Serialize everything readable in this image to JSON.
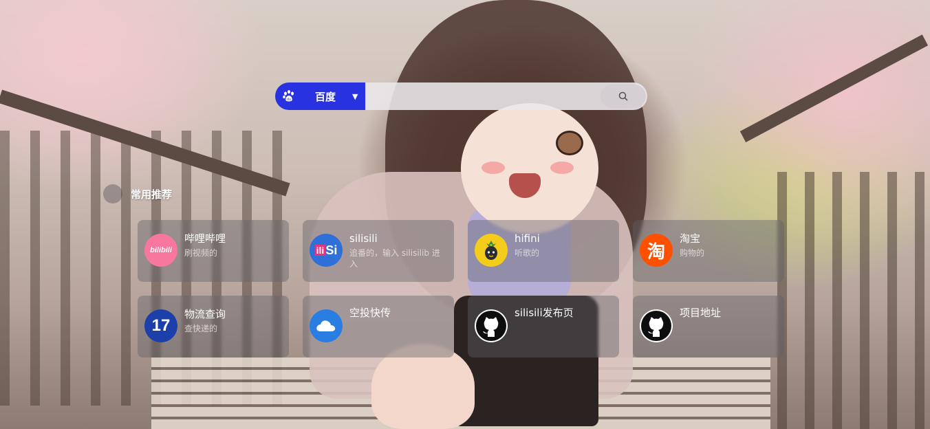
{
  "search": {
    "engine_name": "百度",
    "engine_icon": "baidu-paw-icon",
    "placeholder": "",
    "accent": "#2932e1"
  },
  "section": {
    "title": "常用推荐"
  },
  "cards": [
    {
      "title": "哔哩哔哩",
      "desc": "刷视频的",
      "icon": "bilibili-logo",
      "text_logo": "bilibili"
    },
    {
      "title": "silisili",
      "desc": "追番的，输入 silisilib 进入",
      "icon": "silisili-logo",
      "text_logo_a": "ili",
      "text_logo_b": "Si"
    },
    {
      "title": "hifini",
      "desc": "听歌的",
      "icon": "hifini-logo"
    },
    {
      "title": "淘宝",
      "desc": "购物的",
      "icon": "taobao-logo",
      "text_logo": "淘"
    },
    {
      "title": "物流查询",
      "desc": "查快递的",
      "icon": "17track-logo",
      "text_logo": "17"
    },
    {
      "title": "空投快传",
      "desc": "",
      "icon": "cloud-icon"
    },
    {
      "title": "silisili发布页",
      "desc": "",
      "icon": "github-icon"
    },
    {
      "title": "项目地址",
      "desc": "",
      "icon": "github-icon"
    }
  ]
}
